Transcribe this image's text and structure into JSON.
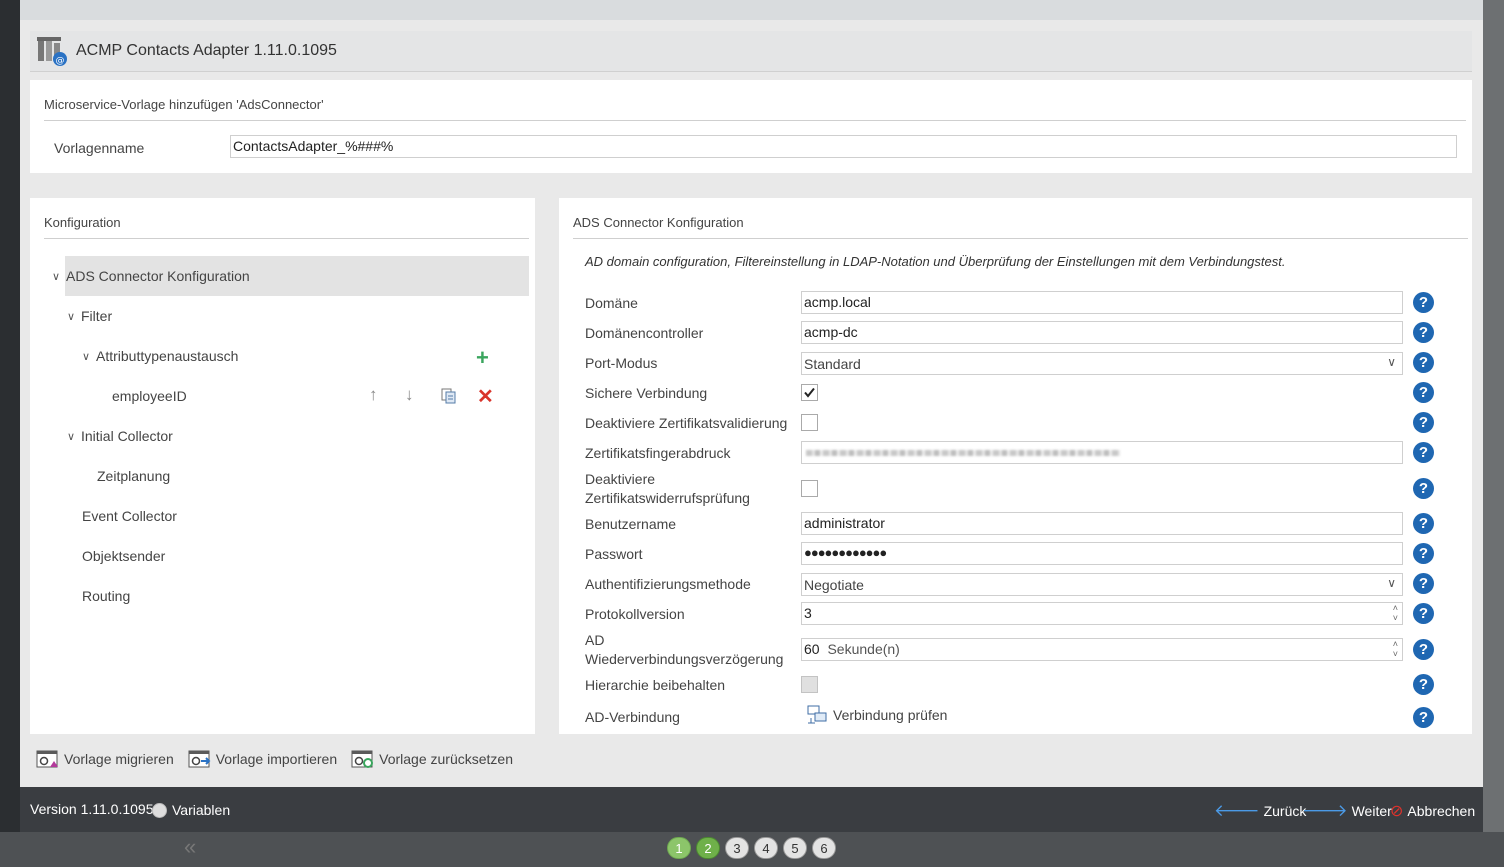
{
  "title": "ACMP Contacts Adapter 1.11.0.1095",
  "template_section": {
    "heading": "Microservice-Vorlage hinzufügen 'AdsConnector'",
    "name_label": "Vorlagenname",
    "name_value": "ContactsAdapter_%###%"
  },
  "config_panel": {
    "heading": "Konfiguration",
    "tree": {
      "root": "ADS Connector Konfiguration",
      "filter": "Filter",
      "attr_exchange": "Attributtypenaustausch",
      "employee": "employeeID",
      "initial": "Initial Collector",
      "schedule": "Zeitplanung",
      "event": "Event Collector",
      "sender": "Objektsender",
      "routing": "Routing"
    }
  },
  "ads_panel": {
    "heading": "ADS Connector Konfiguration",
    "description": "AD domain configuration, Filtereinstellung in LDAP-Notation und Überprüfung der Einstellungen mit dem Verbindungstest.",
    "labels": {
      "domain": "Domäne",
      "dc": "Domänencontroller",
      "port_mode": "Port-Modus",
      "secure": "Sichere Verbindung",
      "cert_disable": "Deaktiviere Zertifikatsvalidierung",
      "fingerprint": "Zertifikatsfingerabdruck",
      "revoke_line1": "Deaktiviere",
      "revoke_line2": "Zertifikatswiderrufsprüfung",
      "user": "Benutzername",
      "password": "Passwort",
      "auth": "Authentifizierungsmethode",
      "protocol": "Protokollversion",
      "reconnect_line1": "AD",
      "reconnect_line2": "Wiederverbindungsverzögerung",
      "hierarchy": "Hierarchie beibehalten",
      "ad_conn": "AD-Verbindung"
    },
    "values": {
      "domain": "acmp.local",
      "dc": "acmp-dc",
      "port_mode": "Standard",
      "secure": true,
      "cert_disable": false,
      "revoke_disable": false,
      "user": "administrator",
      "password": "●●●●●●●●●●●●",
      "auth": "Negotiate",
      "protocol": "3",
      "reconnect_value": "60",
      "reconnect_unit": "Sekunde(n)",
      "hierarchy": false
    },
    "check_connection": "Verbindung prüfen",
    "help_glyph": "?"
  },
  "bottom_links": {
    "migrate": "Vorlage migrieren",
    "import": "Vorlage importieren",
    "reset": "Vorlage zurücksetzen"
  },
  "footer": {
    "version": "Version 1.11.0.1095",
    "variables": "Variablen",
    "back": "Zurück",
    "next": "Weiter",
    "cancel": "Abbrechen"
  },
  "wizard_steps": [
    "1",
    "2",
    "3",
    "4",
    "5",
    "6"
  ],
  "colors": {
    "help_blue": "#1f67b2",
    "add_green": "#3aa55d",
    "delete_red": "#d9342b",
    "step_green": "#6fb04a"
  }
}
